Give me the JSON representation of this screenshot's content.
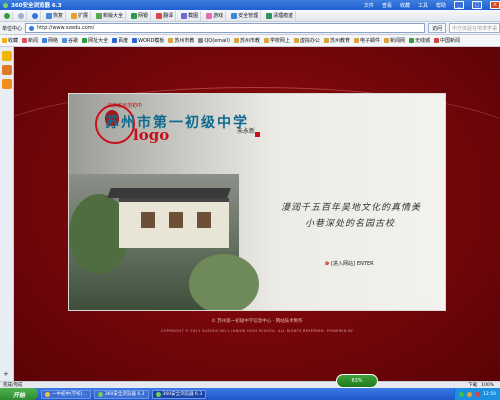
{
  "titlebar": {
    "title": "360安全浏览器 6.3",
    "menu": [
      "文件",
      "查看",
      "收藏",
      "工具",
      "帮助"
    ]
  },
  "toolbar": {
    "items": [
      "恢复",
      "扩展",
      "新版大全",
      "网银",
      "翻译",
      "截图",
      "游戏",
      "安全管理",
      "清理痕迹"
    ]
  },
  "address": {
    "zone": "单位中心",
    "url": "http://www.szedu.com/",
    "go": "访问",
    "search_placeholder": "中方体验在地求学语"
  },
  "favorites": {
    "items": [
      "收藏",
      "新闻",
      "网络",
      "谷歌",
      "网址大全",
      "百度",
      "WORD模板",
      "苏州市教",
      "QQ(email)",
      "苏州市教",
      "学校网上",
      "虚拟办公",
      "苏州教育",
      "电子邮件",
      "新闻网",
      "无线城",
      "中国新闻"
    ]
  },
  "page": {
    "school_small": "江苏省示范初中",
    "school_name": "苏州市第一初级中学",
    "logo_text": "logo",
    "signature": "朱永新",
    "calligraphy_line1": "漫润千五百年吴地文化的真情美",
    "calligraphy_line2": "小巷深处的名园古校",
    "enter_label": "[进入网站]",
    "enter_en": "ENTER",
    "credit": "摄 于 2011",
    "footer_line1": "© 苏州第一初级中学信息中心  ·  网站技术制作",
    "footer_line2": "COPYRIGHT © 2011 SUZHOU NO.1 JUNIOR HIGH SCHOOL. ALL RIGHTS RESERVED. POWERED BY"
  },
  "status": {
    "left": "完成/完成",
    "zoom": "100%",
    "download": "下载"
  },
  "speed": {
    "label": "63%",
    "value": 0.63
  },
  "taskbar": {
    "start": "开始",
    "buttons": [
      "一中初中(学校)...",
      "360安全浏览器 6.3",
      "360安全浏览器 6.3"
    ],
    "time": "12:50"
  }
}
